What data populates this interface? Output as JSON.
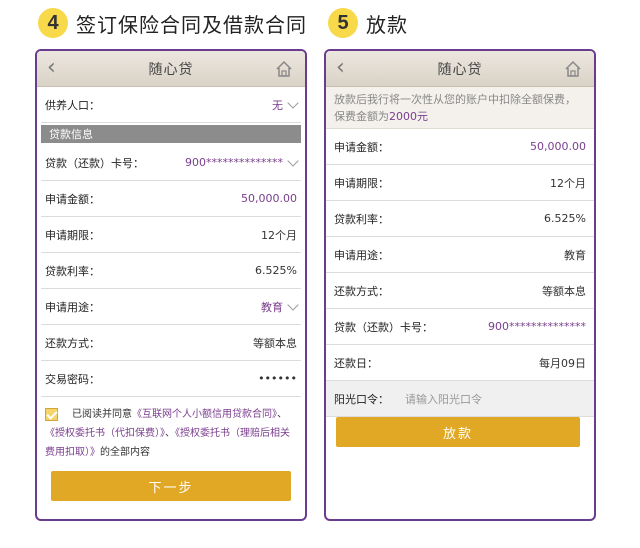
{
  "steps": [
    {
      "num": "4",
      "title": "签订保险合同及借款合同"
    },
    {
      "num": "5",
      "title": "放款"
    }
  ],
  "app": {
    "title": "随心贷",
    "back_icon": "back-chevron-icon",
    "home_icon": "home-icon"
  },
  "screen1": {
    "dependents": {
      "label": "供养人口：",
      "value": "无"
    },
    "section": "贷款信息",
    "rows": [
      {
        "label": "贷款（还款）卡号：",
        "value": "900**************",
        "purple": true,
        "chevron": true
      },
      {
        "label": "申请金额：",
        "value": "50,000.00",
        "purple": true
      },
      {
        "label": "申请期限：",
        "value": "12个月"
      },
      {
        "label": "贷款利率：",
        "value": "6.525%"
      },
      {
        "label": "申请用途：",
        "value": "教育",
        "purple": true,
        "chevron": true
      },
      {
        "label": "还款方式：",
        "value": "等额本息"
      },
      {
        "label": "交易密码：",
        "value": "••••••"
      }
    ],
    "agree": {
      "prefix": "已阅读并同意",
      "link1": "《互联网个人小额信用贷款合同》",
      "sep1": "、",
      "link2": "《授权委托书（代扣保费）》",
      "sep2": "、",
      "link3": "《授权委托书（理赔后相关费用扣取）》",
      "suffix": "的全部内容"
    },
    "next_button": "下一步"
  },
  "screen2": {
    "notice_text": "放款后我行将一次性从您的账户中扣除全额保费，保费金额为",
    "notice_amount": "2000元",
    "rows": [
      {
        "label": "申请金额：",
        "value": "50,000.00",
        "purple": true
      },
      {
        "label": "申请期限：",
        "value": "12个月"
      },
      {
        "label": "贷款利率：",
        "value": "6.525%"
      },
      {
        "label": "申请用途：",
        "value": "教育"
      },
      {
        "label": "还款方式：",
        "value": "等额本息"
      },
      {
        "label": "贷款（还款）卡号：",
        "value": "900**************",
        "purple": true
      },
      {
        "label": "还款日：",
        "value": "每月09日"
      }
    ],
    "sunshine": {
      "label": "阳光口令：",
      "placeholder": "请输入阳光口令"
    },
    "loan_button": "放款"
  },
  "colors": {
    "accent": "#e0a825",
    "frame": "#6b3c8d",
    "link": "#7a3e8e"
  }
}
